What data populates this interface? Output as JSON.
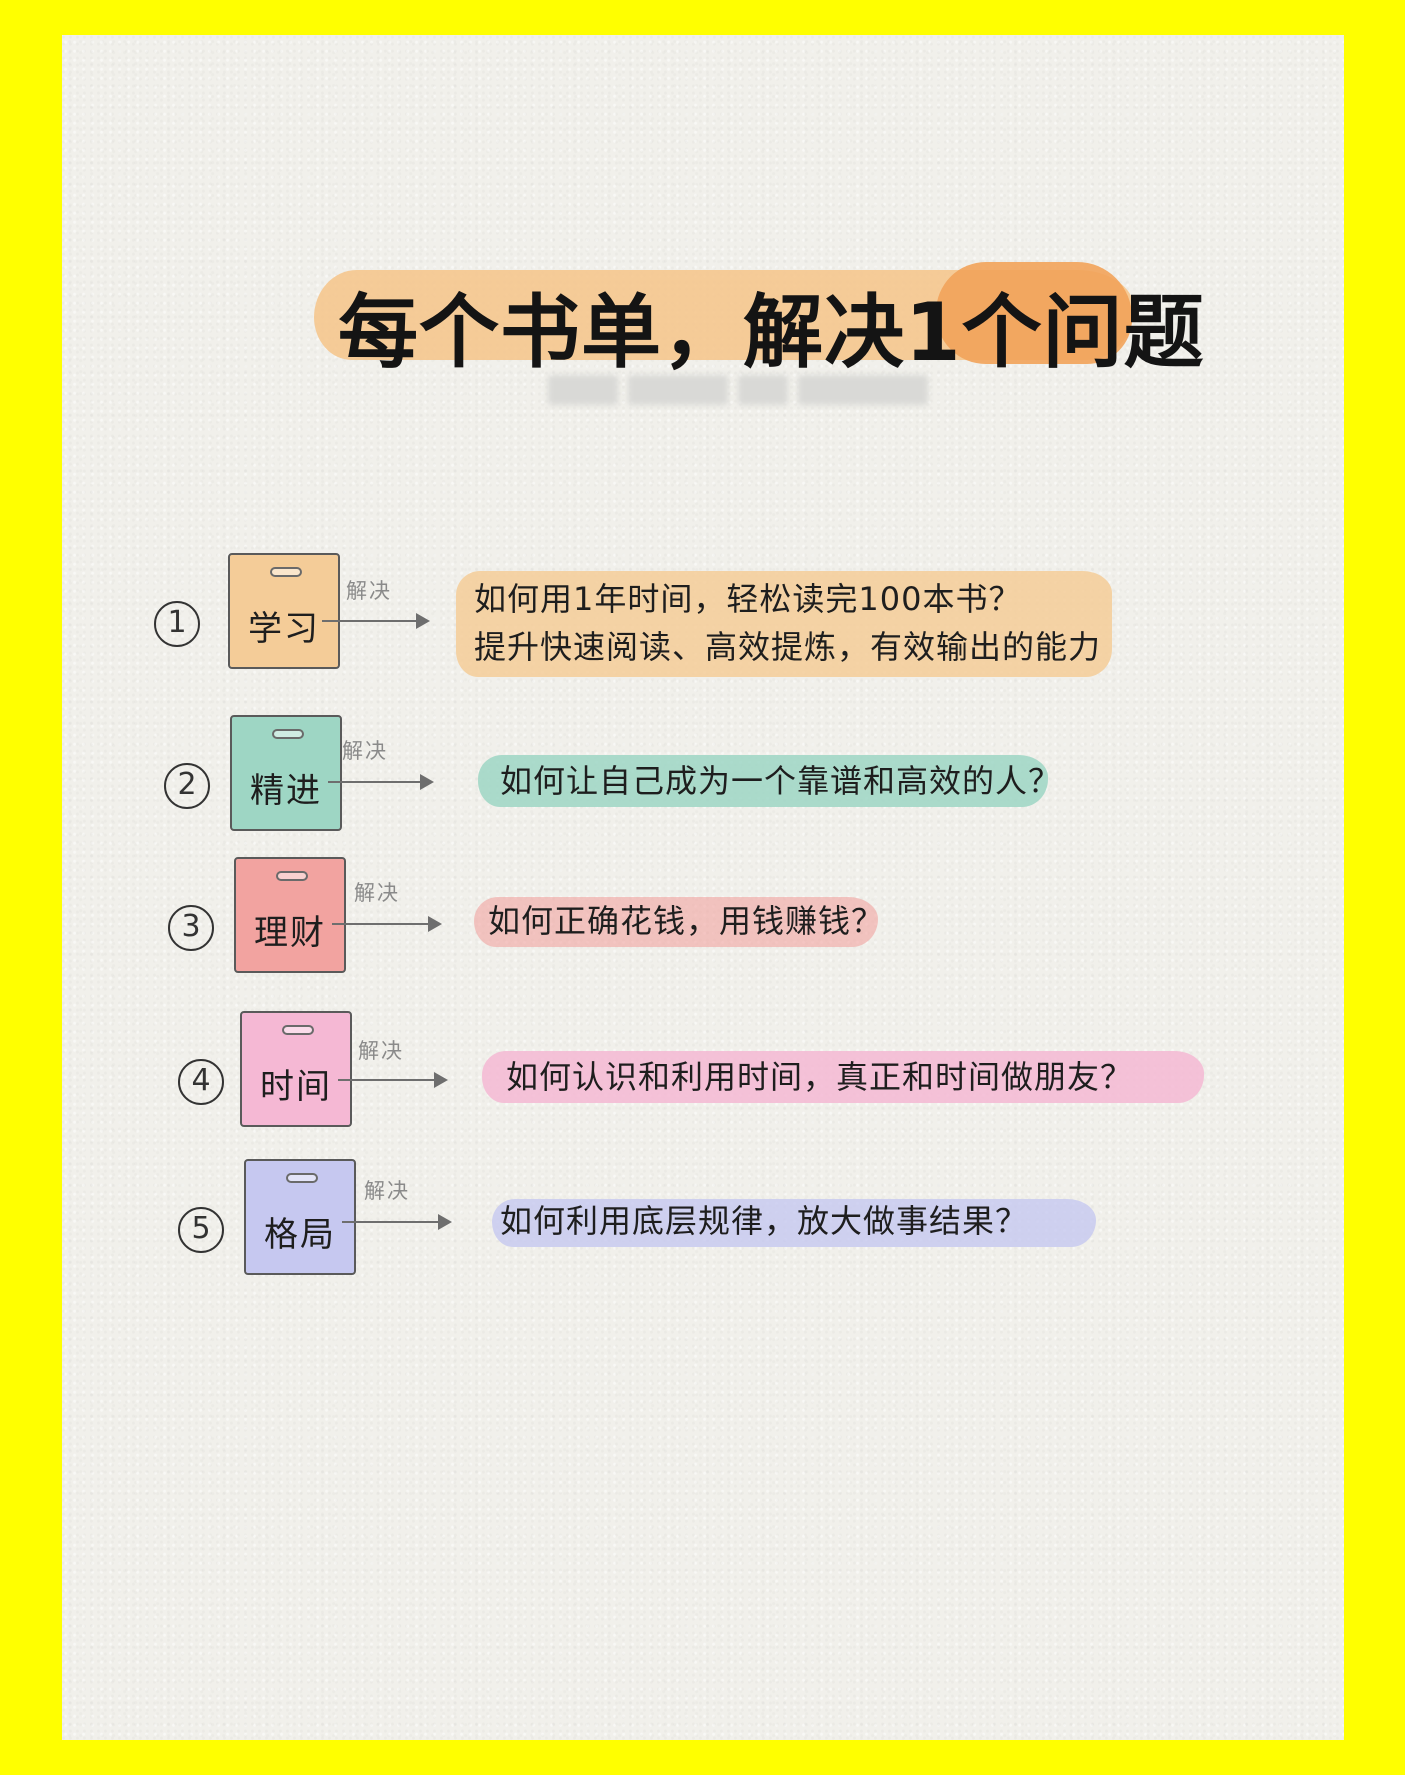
{
  "title": "每个书单，解决1个问题",
  "colors": {
    "background": "#FFFF00",
    "paper": "#F1F0EB",
    "title_highlight": "#F5C68E",
    "title_highlight_accent": "#F2A35A"
  },
  "items": [
    {
      "number": "1",
      "category": "学习",
      "connector": "解决",
      "question_line1": "如何用1年时间，轻松读完100本书？",
      "question_line2": "提升快速阅读、高效提炼，有效输出的能力",
      "color": "#F4CC98"
    },
    {
      "number": "2",
      "category": "精进",
      "connector": "解决",
      "question_line1": "如何让自己成为一个靠谱和高效的人？",
      "question_line2": "",
      "color": "#9ED6C4"
    },
    {
      "number": "3",
      "category": "理财",
      "connector": "解决",
      "question_line1": "如何正确花钱，用钱赚钱？",
      "question_line2": "",
      "color": "#F2A3A0"
    },
    {
      "number": "4",
      "category": "时间",
      "connector": "解决",
      "question_line1": "如何认识和利用时间，真正和时间做朋友？",
      "question_line2": "",
      "color": "#F5B8D4"
    },
    {
      "number": "5",
      "category": "格局",
      "connector": "解决",
      "question_line1": "如何利用底层规律，放大做事结果？",
      "question_line2": "",
      "color": "#C6C8F0"
    }
  ]
}
